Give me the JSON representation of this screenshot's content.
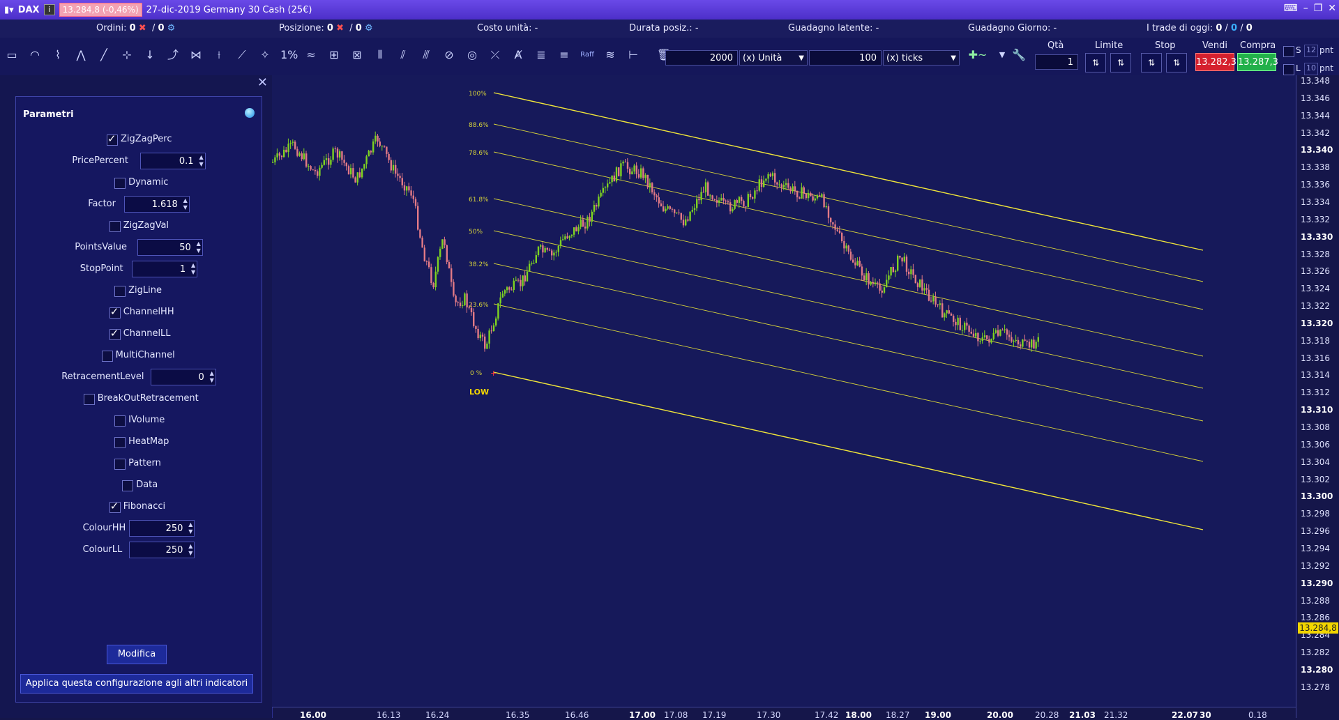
{
  "title": {
    "symbol": "DAX",
    "price_box": "13.284,8 (-0,46%)",
    "description": "27-dic-2019 Germany 30 Cash (25€)"
  },
  "status": {
    "ordini_label": "Ordini:",
    "ordini_value": "0",
    "ordini_sep": "/",
    "ordini_value2": "0",
    "posizione_label": "Posizione:",
    "posizione_value": "0",
    "posizione_sep": "/",
    "posizione_value2": "0",
    "costo": "Costo unità: -",
    "durata": "Durata posiz.: -",
    "latente": "Guadagno latente: -",
    "giorno": "Guadagno Giorno: -",
    "trade_label": "I trade di oggi:",
    "trade_v1": "0",
    "trade_v2": "0",
    "trade_v3": "0"
  },
  "toolbar": {
    "qty_value": "2000",
    "qty_unit": "(x) Unità",
    "ticks_value": "100",
    "ticks_unit": "(x) ticks",
    "raff_label": "Raff",
    "qta_header": "Qtà",
    "qta_value": "1",
    "limite_header": "Limite",
    "stop_header": "Stop",
    "vendi_header": "Vendi",
    "compra_header": "Compra",
    "vendi_price": "13.282,3",
    "compra_price": "13.287,3",
    "s_label": "S",
    "s_value": "12",
    "s_unit": "pnt",
    "l_label": "L",
    "l_value": "10",
    "l_unit": "pnt"
  },
  "panel": {
    "header": "Parametri",
    "params": [
      {
        "label": "ZigZagPerc",
        "type": "check",
        "checked": true
      },
      {
        "label": "PricePercent",
        "type": "num",
        "value": "0.1"
      },
      {
        "label": "Dynamic",
        "type": "check",
        "checked": false
      },
      {
        "label": "Factor",
        "type": "num",
        "value": "1.618"
      },
      {
        "label": "ZigZagVal",
        "type": "check",
        "checked": false
      },
      {
        "label": "PointsValue",
        "type": "num",
        "value": "50"
      },
      {
        "label": "StopPoint",
        "type": "num",
        "value": "1"
      },
      {
        "label": "ZigLine",
        "type": "check",
        "checked": false
      },
      {
        "label": "ChannelHH",
        "type": "check",
        "checked": true
      },
      {
        "label": "ChannelLL",
        "type": "check",
        "checked": true
      },
      {
        "label": "MultiChannel",
        "type": "check",
        "checked": false
      },
      {
        "label": "RetracementLevel",
        "type": "num",
        "value": "0"
      },
      {
        "label": "BreakOutRetracement",
        "type": "check",
        "checked": false
      },
      {
        "label": "IVolume",
        "type": "check",
        "checked": false
      },
      {
        "label": "HeatMap",
        "type": "check",
        "checked": false
      },
      {
        "label": "Pattern",
        "type": "check",
        "checked": false
      },
      {
        "label": "Data",
        "type": "check",
        "checked": false
      },
      {
        "label": "Fibonacci",
        "type": "check",
        "checked": true
      },
      {
        "label": "ColourHH",
        "type": "num",
        "value": "250"
      },
      {
        "label": "ColourLL",
        "type": "num",
        "value": "250"
      }
    ],
    "modifica": "Modifica",
    "apply": "Applica questa configurazione agli altri indicatori"
  },
  "chart": {
    "fib_labels": [
      "100%",
      "88.6%",
      "78.6%",
      "61.8%",
      "50%",
      "38.2%",
      "23.6%",
      "0 %"
    ],
    "low_label": "LOW",
    "last_price": "13.284,8",
    "price_ticks": [
      {
        "v": "13.348",
        "b": false
      },
      {
        "v": "13.346",
        "b": false
      },
      {
        "v": "13.344",
        "b": false
      },
      {
        "v": "13.342",
        "b": false
      },
      {
        "v": "13.340",
        "b": true
      },
      {
        "v": "13.338",
        "b": false
      },
      {
        "v": "13.336",
        "b": false
      },
      {
        "v": "13.334",
        "b": false
      },
      {
        "v": "13.332",
        "b": false
      },
      {
        "v": "13.330",
        "b": true
      },
      {
        "v": "13.328",
        "b": false
      },
      {
        "v": "13.326",
        "b": false
      },
      {
        "v": "13.324",
        "b": false
      },
      {
        "v": "13.322",
        "b": false
      },
      {
        "v": "13.320",
        "b": true
      },
      {
        "v": "13.318",
        "b": false
      },
      {
        "v": "13.316",
        "b": false
      },
      {
        "v": "13.314",
        "b": false
      },
      {
        "v": "13.312",
        "b": false
      },
      {
        "v": "13.310",
        "b": true
      },
      {
        "v": "13.308",
        "b": false
      },
      {
        "v": "13.306",
        "b": false
      },
      {
        "v": "13.304",
        "b": false
      },
      {
        "v": "13.302",
        "b": false
      },
      {
        "v": "13.300",
        "b": true
      },
      {
        "v": "13.298",
        "b": false
      },
      {
        "v": "13.296",
        "b": false
      },
      {
        "v": "13.294",
        "b": false
      },
      {
        "v": "13.292",
        "b": false
      },
      {
        "v": "13.290",
        "b": true
      },
      {
        "v": "13.288",
        "b": false
      },
      {
        "v": "13.286",
        "b": false
      },
      {
        "v": "13.284",
        "b": false
      },
      {
        "v": "13.282",
        "b": false
      },
      {
        "v": "13.280",
        "b": true
      },
      {
        "v": "13.278",
        "b": false
      }
    ],
    "time_ticks": [
      {
        "t": "16.00",
        "b": true
      },
      {
        "t": "16.13",
        "b": false
      },
      {
        "t": "16.24",
        "b": false
      },
      {
        "t": "16.35",
        "b": false
      },
      {
        "t": "16.46",
        "b": false
      },
      {
        "t": "17.00",
        "b": true
      },
      {
        "t": "17.08",
        "b": false
      },
      {
        "t": "17.19",
        "b": false
      },
      {
        "t": "17.30",
        "b": false
      },
      {
        "t": "17.42",
        "b": false
      },
      {
        "t": "18.00",
        "b": true
      },
      {
        "t": "18.27",
        "b": false
      },
      {
        "t": "19.00",
        "b": true
      },
      {
        "t": "20.00",
        "b": true
      },
      {
        "t": "20.28",
        "b": false
      },
      {
        "t": "21.03",
        "b": true
      },
      {
        "t": "21.32",
        "b": false
      },
      {
        "t": "22.07",
        "b": true
      },
      {
        "t": "30",
        "b": true
      },
      {
        "t": "0.18",
        "b": false
      }
    ],
    "colors": {
      "bull": "#7ed321",
      "bear": "#e27a86",
      "fib": "#d6d23a",
      "channel": "#f0e53a"
    }
  }
}
